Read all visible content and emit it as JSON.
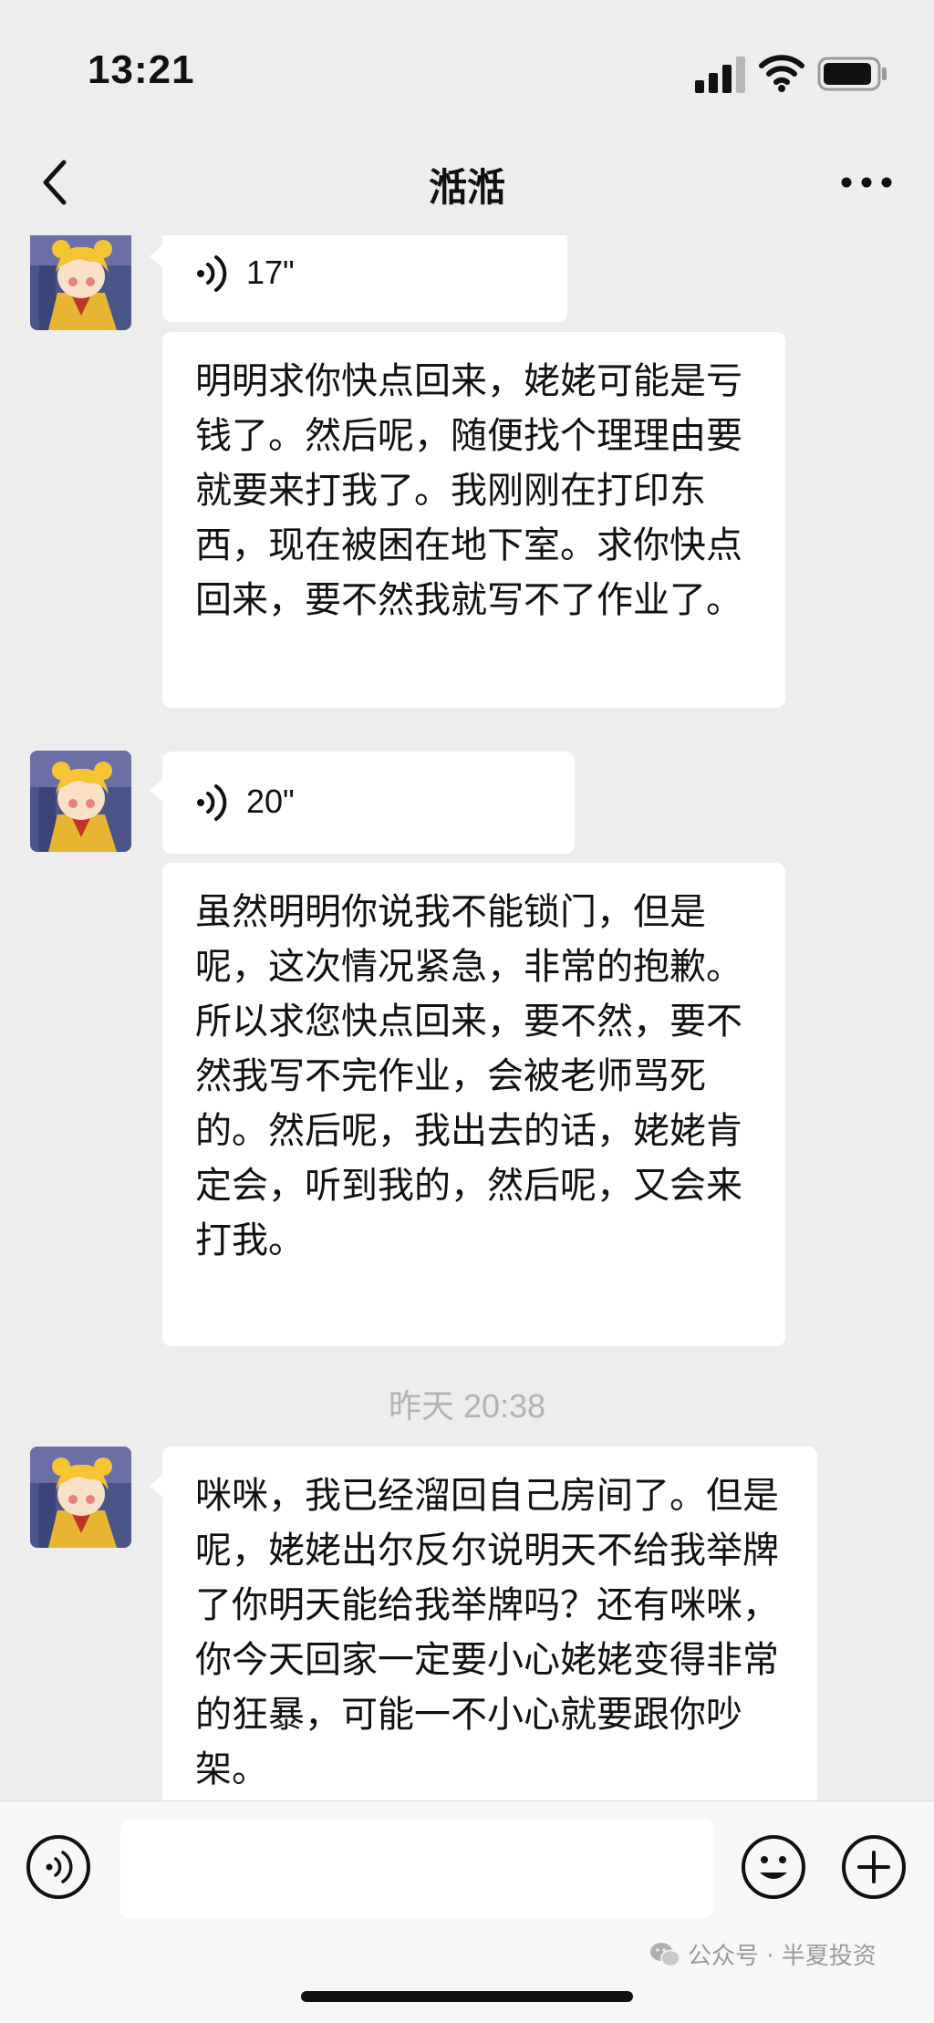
{
  "status_bar": {
    "time": "13:21",
    "battery_icon": "battery-icon",
    "wifi_icon": "wifi-icon",
    "signal_icon": "cellular-signal-icon"
  },
  "nav": {
    "title": "湉湉",
    "back_icon": "chevron-left-icon",
    "more_icon": "more-dots-icon"
  },
  "messages": [
    {
      "type": "voice",
      "duration": "17\""
    },
    {
      "type": "text",
      "text": "明明求你快点回来，姥姥可能是亏钱了。然后呢，随便找个理理由要就要来打我了。我刚刚在打印东西，现在被困在地下室。求你快点回来，要不然我就写不了作业了。"
    },
    {
      "type": "voice",
      "duration": "20\""
    },
    {
      "type": "text",
      "text": "虽然明明你说我不能锁门，但是呢，这次情况紧急，非常的抱歉。所以求您快点回来，要不然，要不然我写不完作业，会被老师骂死的。然后呢，我出去的话，姥姥肯定会，听到我的，然后呢，又会来打我。"
    },
    {
      "type": "timestamp",
      "text": "昨天 20:38"
    },
    {
      "type": "text",
      "text": "咪咪，我已经溜回自己房间了。但是呢，姥姥出尔反尔说明天不给我举牌了你明天能给我举牌吗？还有咪咪，你今天回家一定要小心姥姥变得非常的狂暴，可能一不小心就要跟你吵架。"
    }
  ],
  "input_bar": {
    "voice_icon": "voice-input-icon",
    "emoji_icon": "emoji-icon",
    "plus_icon": "plus-icon",
    "input_value": ""
  },
  "watermark": {
    "text": "公众号 · 半夏投资",
    "icon": "wechat-icon"
  },
  "colors": {
    "background": "#ededed",
    "bubble": "#ffffff",
    "timestamp": "#b3b3b3",
    "input_bar": "#f7f7f7"
  }
}
